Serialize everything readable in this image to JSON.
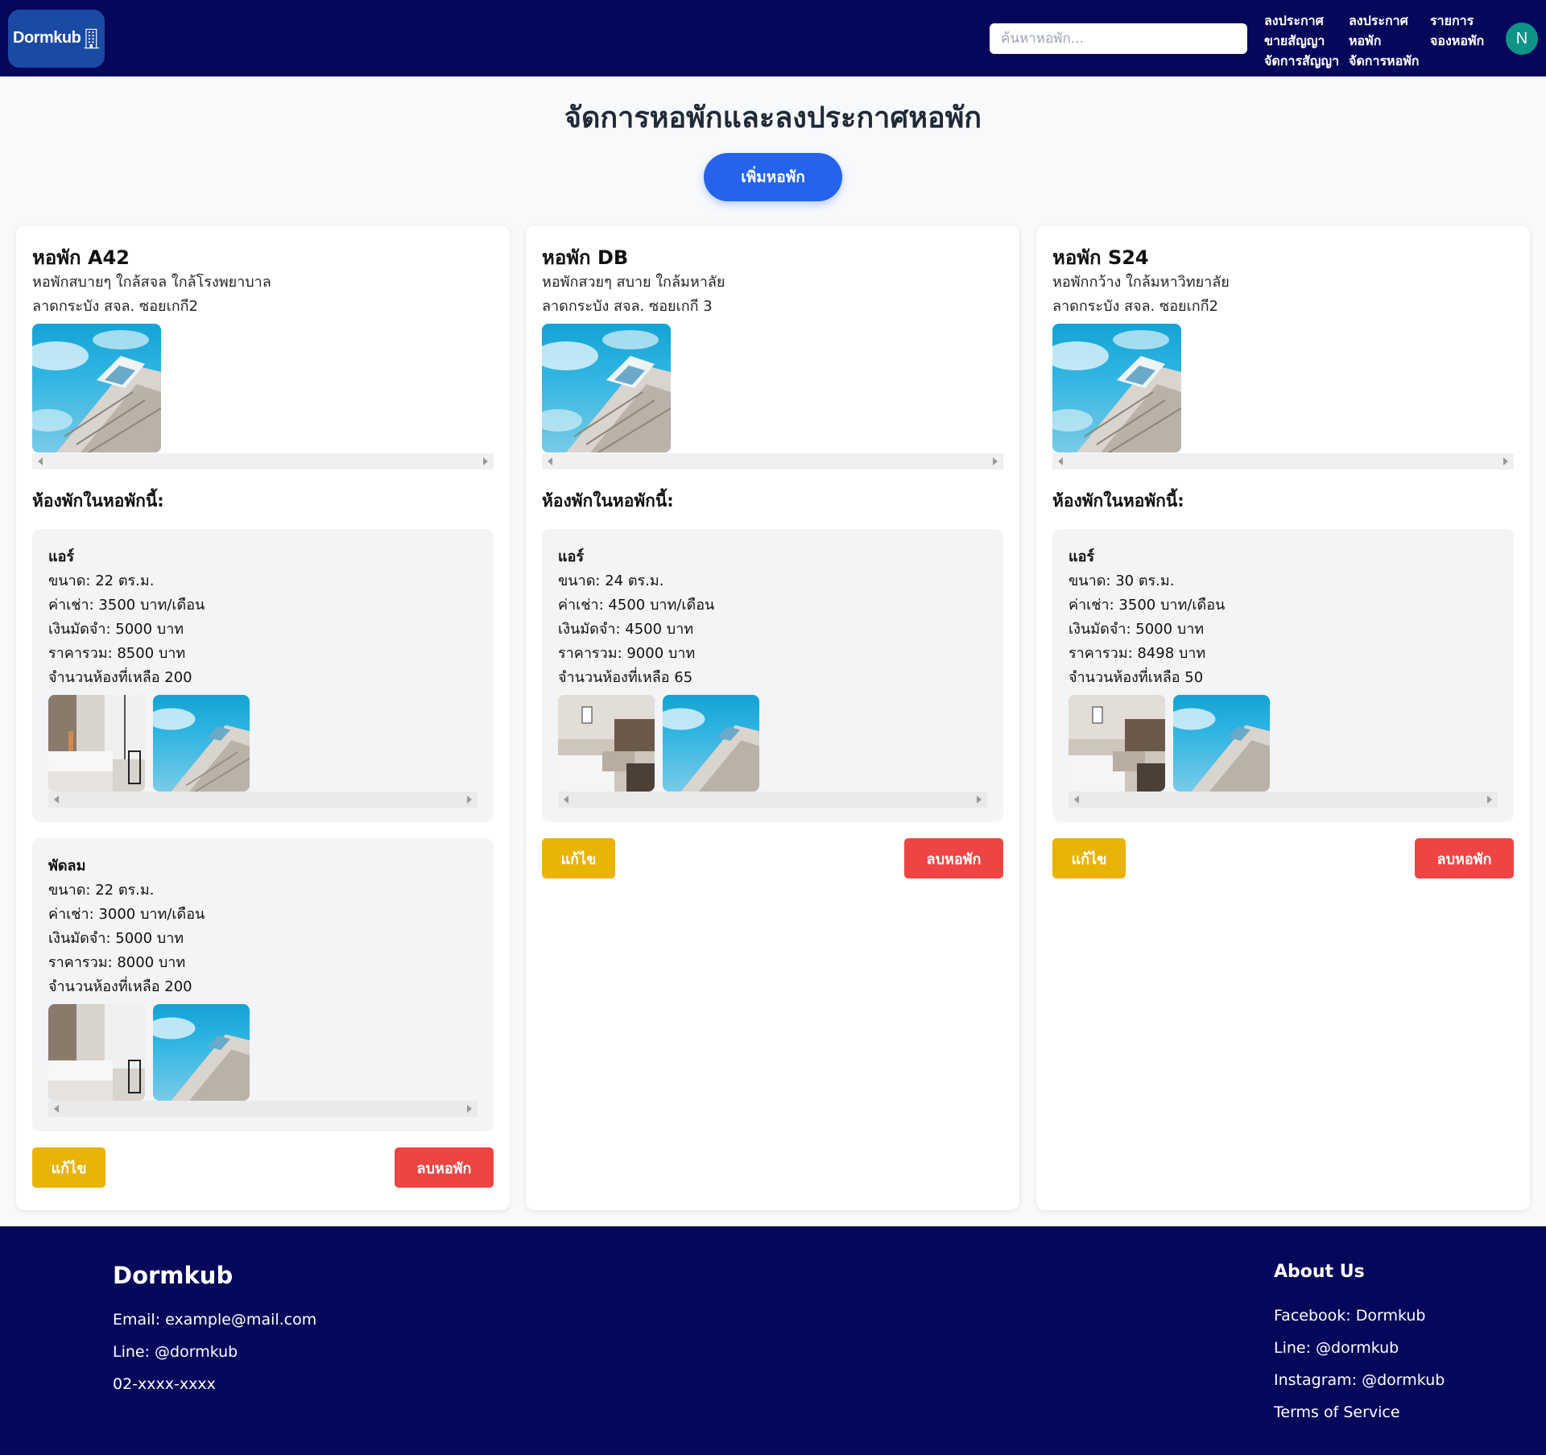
{
  "header": {
    "logo_text": "Dormkub",
    "search_placeholder": "ค้นหาหอพัก...",
    "nav": [
      {
        "line1": "ลงประกาศ",
        "line2": "ขายสัญญา",
        "line3": "จัดการสัญญา"
      },
      {
        "line1": "ลงประกาศ",
        "line2": "หอพัก",
        "line3": "จัดการหอพัก"
      },
      {
        "line1": "รายการ",
        "line2": "จองหอพัก",
        "line3": ""
      }
    ],
    "avatar_letter": "N"
  },
  "main": {
    "title": "จัดการหอพักและลงประกาศหอพัก",
    "add_button": "เพิ่มหอพัก",
    "rooms_heading": "ห้องพักในหอพักนี้:",
    "edit_label": "แก้ไข",
    "delete_label": "ลบหอพัก"
  },
  "dorms": [
    {
      "name": "หอพัก A42",
      "description": "หอพักสบายๆ ใกล้สจล ใกล้โรงพยาบาล",
      "address": "ลาดกระบัง สจล. ซอยเกกี2",
      "rooms": [
        {
          "type": "แอร์",
          "size": "ขนาด: 22 ตร.ม.",
          "rent": "ค่าเช่า: 3500 บาท/เดือน",
          "deposit": "เงินมัดจำ: 5000 บาท",
          "total": "ราคารวม: 8500 บาท",
          "remaining": "จำนวนห้องที่เหลือ 200"
        },
        {
          "type": "พัดลม",
          "size": "ขนาด: 22 ตร.ม.",
          "rent": "ค่าเช่า: 3000 บาท/เดือน",
          "deposit": "เงินมัดจำ: 5000 บาท",
          "total": "ราคารวม: 8000 บาท",
          "remaining": "จำนวนห้องที่เหลือ 200"
        }
      ]
    },
    {
      "name": "หอพัก DB",
      "description": "หอพักสวยๆ สบาย ใกล้มหาลัย",
      "address": "ลาดกระบัง สจล. ซอยเกกี 3",
      "rooms": [
        {
          "type": "แอร์",
          "size": "ขนาด: 24 ตร.ม.",
          "rent": "ค่าเช่า: 4500 บาท/เดือน",
          "deposit": "เงินมัดจำ: 4500 บาท",
          "total": "ราคารวม: 9000 บาท",
          "remaining": "จำนวนห้องที่เหลือ 65"
        }
      ]
    },
    {
      "name": "หอพัก S24",
      "description": "หอพักกว้าง ใกล้มหาวิทยาลัย",
      "address": "ลาดกระบัง สจล. ซอยเกกี2",
      "rooms": [
        {
          "type": "แอร์",
          "size": "ขนาด: 30 ตร.ม.",
          "rent": "ค่าเช่า: 3500 บาท/เดือน",
          "deposit": "เงินมัดจำ: 5000 บาท",
          "total": "ราคารวม: 8498 บาท",
          "remaining": "จำนวนห้องที่เหลือ 50"
        }
      ]
    }
  ],
  "footer": {
    "brand": "Dormkub",
    "email": "Email: example@mail.com",
    "line": "Line: @dormkub",
    "phone": "02-xxxx-xxxx",
    "about_title": "About Us",
    "facebook": "Facebook: Dormkub",
    "about_line": "Line: @dormkub",
    "instagram": "Instagram: @dormkub",
    "terms": "Terms of Service"
  },
  "colors": {
    "navy": "#04075a",
    "primary": "#2563eb",
    "edit": "#eab308",
    "delete": "#ef4444",
    "avatar": "#0d9488"
  }
}
